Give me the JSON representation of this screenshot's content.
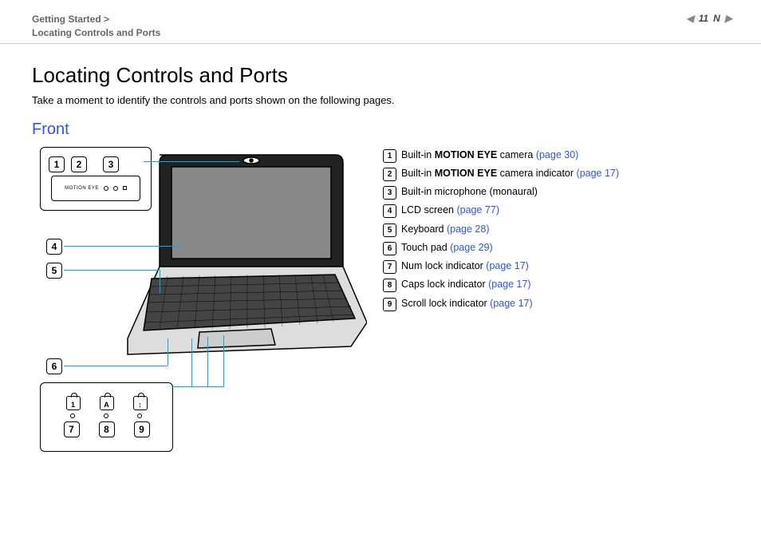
{
  "header": {
    "breadcrumb_line1": "Getting Started >",
    "breadcrumb_line2": "Locating Controls and Ports",
    "page_number": "11",
    "nav_letter": "N"
  },
  "title": "Locating Controls and Ports",
  "intro": "Take a moment to identify the controls and ports shown on the following pages.",
  "section_heading": "Front",
  "callouts": {
    "top": [
      "1",
      "2",
      "3"
    ],
    "left": [
      "4",
      "5",
      "6"
    ],
    "bottom_locks": [
      "1",
      "A",
      "↕"
    ],
    "bottom_nums": [
      "7",
      "8",
      "9"
    ]
  },
  "legend": [
    {
      "num": "1",
      "text_pre": "Built-in ",
      "bold": "MOTION EYE",
      "text_post": " camera ",
      "ref": "(page 30)"
    },
    {
      "num": "2",
      "text_pre": "Built-in ",
      "bold": "MOTION EYE",
      "text_post": " camera indicator ",
      "ref": "(page 17)"
    },
    {
      "num": "3",
      "text_pre": "Built-in microphone (monaural)",
      "bold": "",
      "text_post": "",
      "ref": ""
    },
    {
      "num": "4",
      "text_pre": "LCD screen ",
      "bold": "",
      "text_post": "",
      "ref": "(page 77)"
    },
    {
      "num": "5",
      "text_pre": "Keyboard ",
      "bold": "",
      "text_post": "",
      "ref": "(page 28)"
    },
    {
      "num": "6",
      "text_pre": "Touch pad ",
      "bold": "",
      "text_post": "",
      "ref": "(page 29)"
    },
    {
      "num": "7",
      "text_pre": "Num lock indicator ",
      "bold": "",
      "text_post": "",
      "ref": "(page 17)"
    },
    {
      "num": "8",
      "text_pre": "Caps lock indicator ",
      "bold": "",
      "text_post": "",
      "ref": "(page 17)"
    },
    {
      "num": "9",
      "text_pre": "Scroll lock indicator ",
      "bold": "",
      "text_post": "",
      "ref": "(page 17)"
    }
  ]
}
